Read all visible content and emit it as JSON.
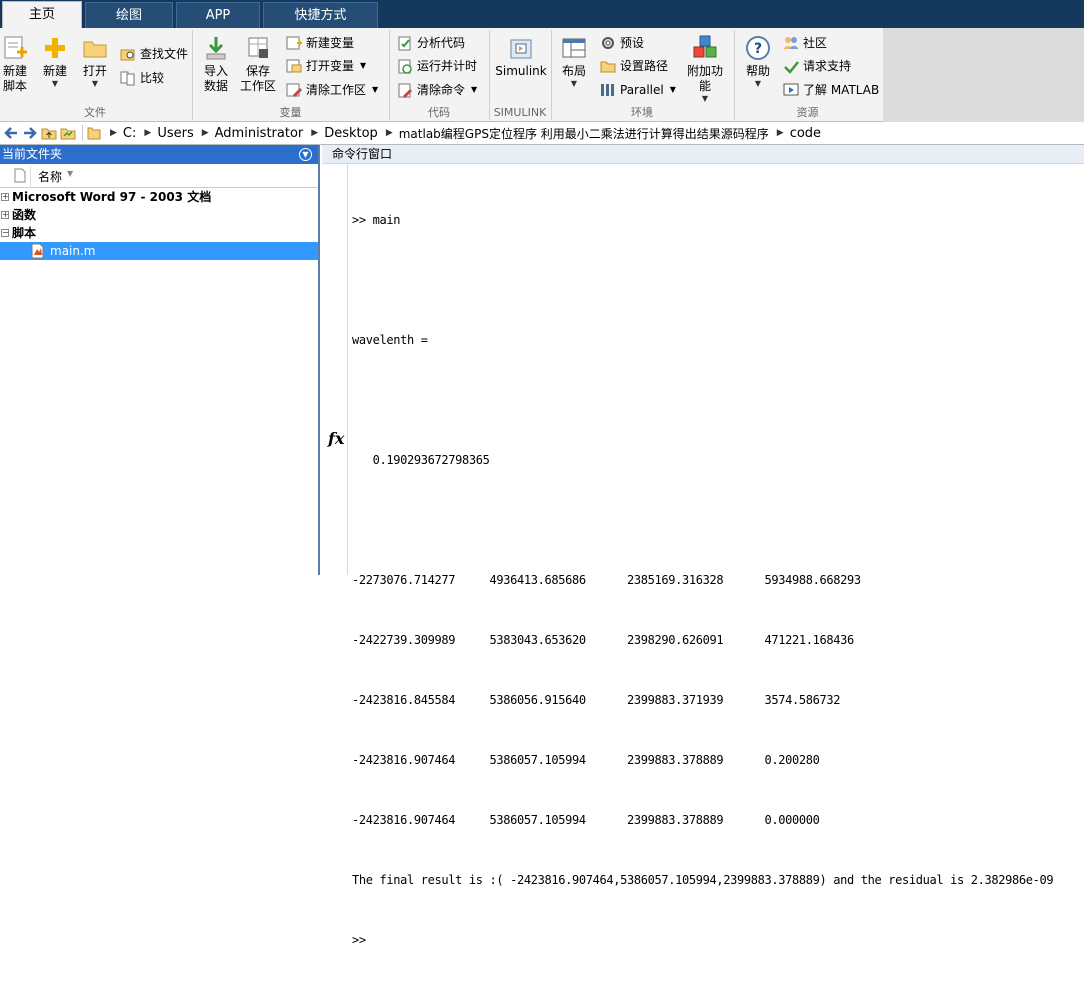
{
  "tabs": [
    "主页",
    "绘图",
    "APP",
    "快捷方式"
  ],
  "toolstrip": {
    "file": {
      "new_script": "新建\n脚本",
      "new": "新建",
      "open": "打开",
      "find_files": "查找文件",
      "compare": "比较",
      "group": "文件"
    },
    "variable": {
      "import": "导入\n数据",
      "save": "保存\n工作区",
      "new_var": "新建变量",
      "open_var": "打开变量",
      "clear_ws": "清除工作区",
      "group": "变量"
    },
    "code": {
      "analyze": "分析代码",
      "run_time": "运行并计时",
      "clear_cmd": "清除命令",
      "group": "代码"
    },
    "simulink": {
      "label": "Simulink",
      "group": "SIMULINK"
    },
    "env": {
      "layout": "布局",
      "prefs": "预设",
      "set_path": "设置路径",
      "parallel": "Parallel",
      "addons": "附加功能",
      "group": "环境"
    },
    "resources": {
      "help": "帮助",
      "community": "社区",
      "support": "请求支持",
      "learn": "了解 MATLAB",
      "group": "资源"
    }
  },
  "address": [
    "C:",
    "Users",
    "Administrator",
    "Desktop",
    "matlab编程GPS定位程序 利用最小二乘法进行计算得出结果源码程序",
    "code"
  ],
  "current_folder": {
    "title": "当前文件夹",
    "col_name": "名称",
    "groups": [
      "Microsoft Word 97 - 2003 文档",
      "函数",
      "脚本"
    ],
    "selected_file": "main.m"
  },
  "command_window": {
    "title": "命令行窗口",
    "lines": [
      ">> main",
      "",
      "wavelenth =",
      "",
      "   0.190293672798365",
      "",
      "-2273076.714277     4936413.685686      2385169.316328      5934988.668293",
      "-2422739.309989     5383043.653620      2398290.626091      471221.168436",
      "-2423816.845584     5386056.915640      2399883.371939      3574.586732",
      "-2423816.907464     5386057.105994      2399883.378889      0.200280",
      "-2423816.907464     5386057.105994      2399883.378889      0.000000",
      "The final result is :( -2423816.907464,5386057.105994,2399883.378889) and the residual is 2.382986e-09",
      ">> "
    ],
    "fx": "fx"
  }
}
